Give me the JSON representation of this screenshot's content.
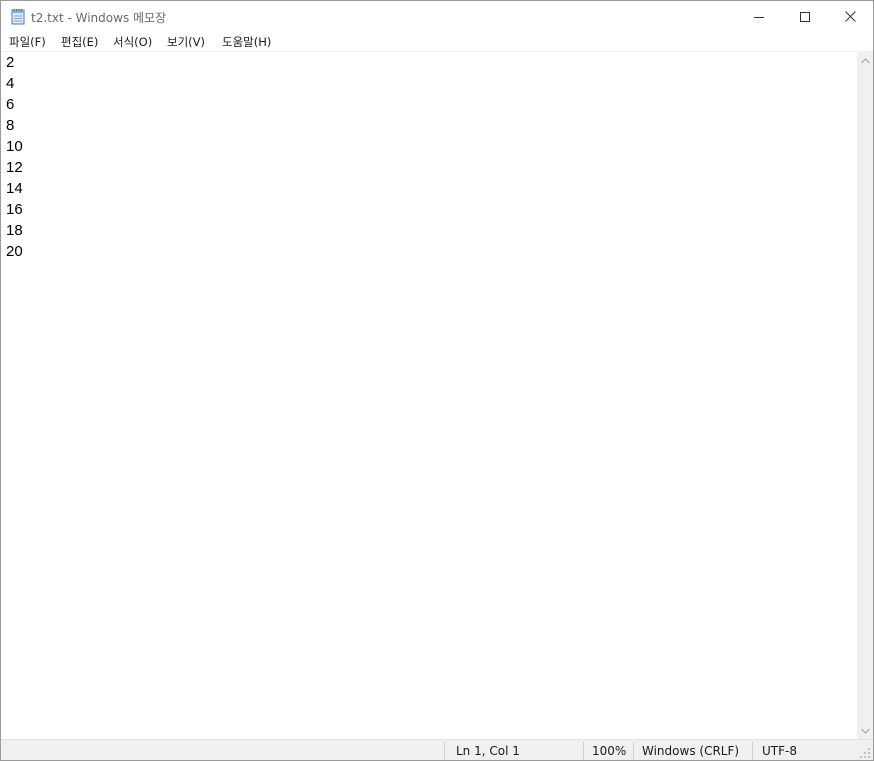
{
  "window": {
    "title": "t2.txt - Windows 메모장",
    "app_icon": "notepad-icon"
  },
  "menu": {
    "file": "파일(F)",
    "edit": "편집(E)",
    "format": "서식(O)",
    "view": "보기(V)",
    "help": "도움말(H)"
  },
  "editor": {
    "lines": [
      "2",
      "4",
      "6",
      "8",
      "10",
      "12",
      "14",
      "16",
      "18",
      "20"
    ]
  },
  "status": {
    "position": "Ln 1, Col 1",
    "zoom": "100%",
    "line_ending": "Windows (CRLF)",
    "encoding": "UTF-8"
  },
  "colors": {
    "window_border": "#9a9a9a",
    "statusbar_bg": "#f0f0f0",
    "title_text": "#6a6a6a"
  }
}
